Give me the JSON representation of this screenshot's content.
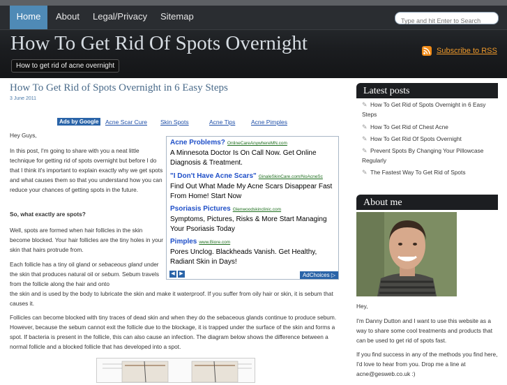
{
  "nav": {
    "items": [
      "Home",
      "About",
      "Legal/Privacy",
      "Sitemap"
    ],
    "search_placeholder": "Type and hit Enter to Search"
  },
  "header": {
    "title": "How To Get Rid Of Spots Overnight",
    "tagline": "How to get rid of acne overnight",
    "rss_label": "Subscribe to RSS"
  },
  "post": {
    "title": "How To Get Rid of Spots Overnight in 6 Easy Steps",
    "date": "3 June 2011",
    "ads_by": "Ads by Google",
    "ad_links": [
      "Acne Scar Cure",
      "Skin Spots",
      "Acne Tips",
      "Acne Pimples"
    ],
    "greeting": "Hey Guys,",
    "para1": "In this post, I'm going to share with you a neat little technique for getting rid of spots overnight but before I do that I think it's important to explain exactly why we get spots and what causes them so that you understand how you can reduce your chances of getting spots in the future.",
    "heading": "So, what exactly are spots?",
    "para2": "Well, spots are formed when hair follicles in the skin become blocked. Your hair follicles are the tiny holes in your skin that hairs protrude from.",
    "para3a": "Each follicle has a tiny oil gland or ",
    "para3_em1": "sebaceous gland",
    "para3b": " under the skin that produces natural oil or ",
    "para3_em2": "sebum.",
    "para3c": " Sebum travels from the follicle along the hair and onto",
    "para3d": "the skin and is used by the body to lubricate the skin and make it waterproof. If you suffer from oily hair or skin, it is sebum that causes it.",
    "para4": "Follicles can become blocked with tiny traces of dead skin and when they do the sebaceous glands continue to produce sebum. However, because the sebum cannot exit the follicle due to the blockage, it is trapped under the surface of the skin and forms a spot. If bacteria is present in the follicle, this can also cause an infection. The diagram below shows the difference between a normal follicle and a blocked follicle that has developed into a spot."
  },
  "ads": [
    {
      "headline": "Acne Problems?",
      "url": "OnlineCareAnywhereMN.com",
      "text": "A Minnesota Doctor Is On Call Now. Get Online Diagnosis & Treatment."
    },
    {
      "headline": "\"I Don't Have Acne Scars\"",
      "url": "GinaleSkinCare.com/NoAcneSc",
      "text": "Find Out What Made My Acne Scars Disappear Fast From Home! Start Now"
    },
    {
      "headline": "Psoriasis Pictures",
      "url": "Glenwoodskinclinic.com",
      "text": "Symptoms, Pictures, Risks & More Start Managing Your Psoriasis Today"
    },
    {
      "headline": "Pimples",
      "url": "www.Biore.com",
      "text": "Pores Unclog. Blackheads Vanish. Get Healthy, Radiant Skin in Days!"
    }
  ],
  "adchoices": "AdChoices",
  "sidebar": {
    "latest_title": "Latest posts",
    "latest": [
      "How To Get Rid of Spots Overnight in 6 Easy Steps",
      "How To Get Rid of Chest Acne",
      "How To Get Rid Of Spots Overnight",
      "Prevent Spots By Changing Your Pillowcase Regularly",
      "The Fastest Way To Get Rid of Spots"
    ],
    "about_title": "About me",
    "about_hey": "Hey,",
    "about_p1": "I'm Danny Dutton and I want to use this website as a way to share some cool treatments and products that can be used to get rid of spots fast.",
    "about_p2": "If you find success in any of the methods you find here, I'd love to hear from you. Drop me a line at acne@gesweb.co.uk :)"
  },
  "colors": {
    "nav_active": "#4f8ab6",
    "header_bg": "#1b1d20",
    "link": "#1f4fa8",
    "rss": "#f08a17"
  }
}
